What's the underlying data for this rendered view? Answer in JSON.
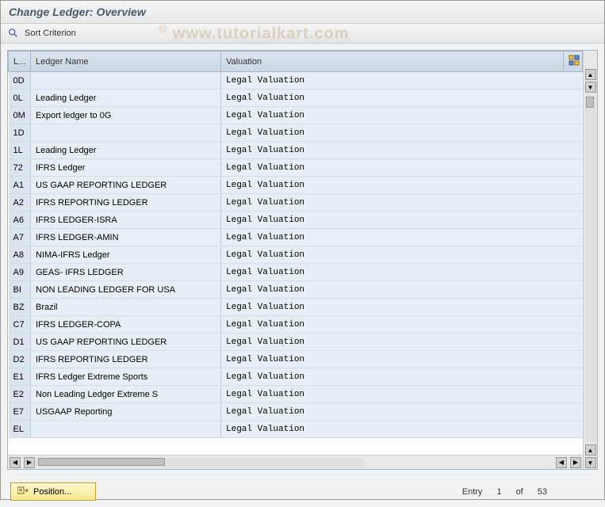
{
  "title": "Change Ledger: Overview",
  "toolbar": {
    "sort_label": "Sort Criterion"
  },
  "watermark": "www.tutorialkart.com",
  "columns": {
    "code": "L...",
    "name": "Ledger Name",
    "valuation": "Valuation"
  },
  "rows": [
    {
      "code": "0D",
      "name": "",
      "val": "Legal Valuation"
    },
    {
      "code": "0L",
      "name": "Leading Ledger",
      "val": "Legal Valuation"
    },
    {
      "code": "0M",
      "name": "Export ledger to 0G",
      "val": "Legal Valuation"
    },
    {
      "code": "1D",
      "name": "",
      "val": "Legal Valuation"
    },
    {
      "code": "1L",
      "name": "Leading Ledger",
      "val": "Legal Valuation"
    },
    {
      "code": "72",
      "name": "IFRS Ledger",
      "val": "Legal Valuation"
    },
    {
      "code": "A1",
      "name": "US GAAP REPORTING LEDGER",
      "val": "Legal Valuation"
    },
    {
      "code": "A2",
      "name": "IFRS REPORTING LEDGER",
      "val": "Legal Valuation"
    },
    {
      "code": "A6",
      "name": "IFRS LEDGER-ISRA",
      "val": "Legal Valuation"
    },
    {
      "code": "A7",
      "name": "IFRS LEDGER-AMIN",
      "val": "Legal Valuation"
    },
    {
      "code": "A8",
      "name": "NIMA-IFRS Ledger",
      "val": "Legal Valuation"
    },
    {
      "code": "A9",
      "name": "GEAS- IFRS LEDGER",
      "val": "Legal Valuation"
    },
    {
      "code": "BI",
      "name": "NON LEADING LEDGER FOR USA",
      "val": "Legal Valuation"
    },
    {
      "code": "BZ",
      "name": "Brazil",
      "val": "Legal Valuation"
    },
    {
      "code": "C7",
      "name": "IFRS LEDGER-COPA",
      "val": "Legal Valuation"
    },
    {
      "code": "D1",
      "name": "US GAAP REPORTING LEDGER",
      "val": "Legal Valuation"
    },
    {
      "code": "D2",
      "name": "IFRS REPORTING LEDGER",
      "val": "Legal Valuation"
    },
    {
      "code": "E1",
      "name": "IFRS Ledger Extreme Sports",
      "val": "Legal Valuation"
    },
    {
      "code": "E2",
      "name": "Non Leading Ledger Extreme S",
      "val": "Legal Valuation"
    },
    {
      "code": "E7",
      "name": "USGAAP Reporting",
      "val": "Legal Valuation"
    },
    {
      "code": "EL",
      "name": "",
      "val": "Legal Valuation"
    }
  ],
  "footer": {
    "position_label": "Position...",
    "entry_label": "Entry",
    "entry_current": "1",
    "entry_of": "of",
    "entry_total": "53"
  }
}
